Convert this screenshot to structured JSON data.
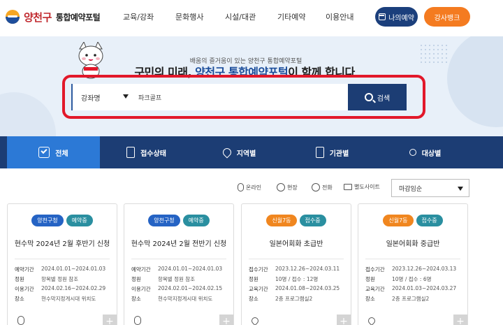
{
  "header": {
    "logo_main": "양천구",
    "logo_sub": "통합예약포털",
    "nav": [
      "교육/강좌",
      "문화행사",
      "시설/대관",
      "기타예약",
      "이용안내"
    ],
    "my_reservation": "나의예약",
    "instructor_bank": "강사뱅크"
  },
  "hero": {
    "sub_copy": "배움의 즐거움이 있는 양천구 통합예약포털",
    "copy_before": "구민의 미래, ",
    "copy_accent": "양천구 통합예약포털",
    "copy_after": "이 함께 합니다",
    "search": {
      "category": "강좌명",
      "value": "파크골프",
      "button": "검색"
    }
  },
  "tabs": [
    {
      "label": "전체",
      "icon": "check-icon",
      "active": true
    },
    {
      "label": "접수상태",
      "icon": "clipboard-icon",
      "active": false
    },
    {
      "label": "지역별",
      "icon": "map-pin-icon",
      "active": false
    },
    {
      "label": "기관별",
      "icon": "building-icon",
      "active": false
    },
    {
      "label": "대상별",
      "icon": "people-icon",
      "active": false
    }
  ],
  "filters": {
    "online": "온라인",
    "onsite": "현장",
    "phone": "전화",
    "external_site": "별도사이트",
    "sort": "마감임순"
  },
  "cards": [
    {
      "badges": [
        {
          "text": "양천구청",
          "color": "blue"
        },
        {
          "text": "예약중",
          "color": "teal"
        }
      ],
      "title": "현수막 2024년 2월 후반기 신청",
      "info": [
        {
          "key": "예약기간",
          "val": "2024.01.01~2024.01.03"
        },
        {
          "key": "정원",
          "val": "항목별 정원 참조"
        },
        {
          "key": "이용기간",
          "val": "2024.02.16~2024.02.29"
        },
        {
          "key": "장소",
          "val": "현수막지정게시대 위치도"
        }
      ],
      "foot_icon": "mouse-icon"
    },
    {
      "badges": [
        {
          "text": "양천구청",
          "color": "blue"
        },
        {
          "text": "예약중",
          "color": "teal"
        }
      ],
      "title": "현수막 2024년 2월 전반기 신청",
      "info": [
        {
          "key": "예약기간",
          "val": "2024.01.01~2024.01.03"
        },
        {
          "key": "정원",
          "val": "항목별 정원 참조"
        },
        {
          "key": "이용기간",
          "val": "2024.02.01~2024.02.15"
        },
        {
          "key": "장소",
          "val": "현수막지정게시대 위치도"
        }
      ],
      "foot_icon": "mouse-icon"
    },
    {
      "badges": [
        {
          "text": "신월7동",
          "color": "orange"
        },
        {
          "text": "접수중",
          "color": "teal"
        }
      ],
      "title": "일본어회화 초급반",
      "info": [
        {
          "key": "접수기간",
          "val": "2023.12.26~2024.03.11"
        },
        {
          "key": "정원",
          "val": "10명 / 접수 : 12명"
        },
        {
          "key": "교육기간",
          "val": "2024.01.08~2024.03.25"
        },
        {
          "key": "장소",
          "val": "2층 프로그램실2"
        }
      ],
      "foot_icon": "map-pin-icon"
    },
    {
      "badges": [
        {
          "text": "신월7동",
          "color": "orange"
        },
        {
          "text": "접수중",
          "color": "teal"
        }
      ],
      "title": "일본어회화 중급반",
      "info": [
        {
          "key": "접수기간",
          "val": "2023.12.26~2024.03.13"
        },
        {
          "key": "정원",
          "val": "10명 / 접수 : 6명"
        },
        {
          "key": "교육기간",
          "val": "2024.01.03~2024.03.27"
        },
        {
          "key": "장소",
          "val": "2층 프로그램실2"
        }
      ],
      "foot_icon": "map-pin-icon"
    }
  ]
}
